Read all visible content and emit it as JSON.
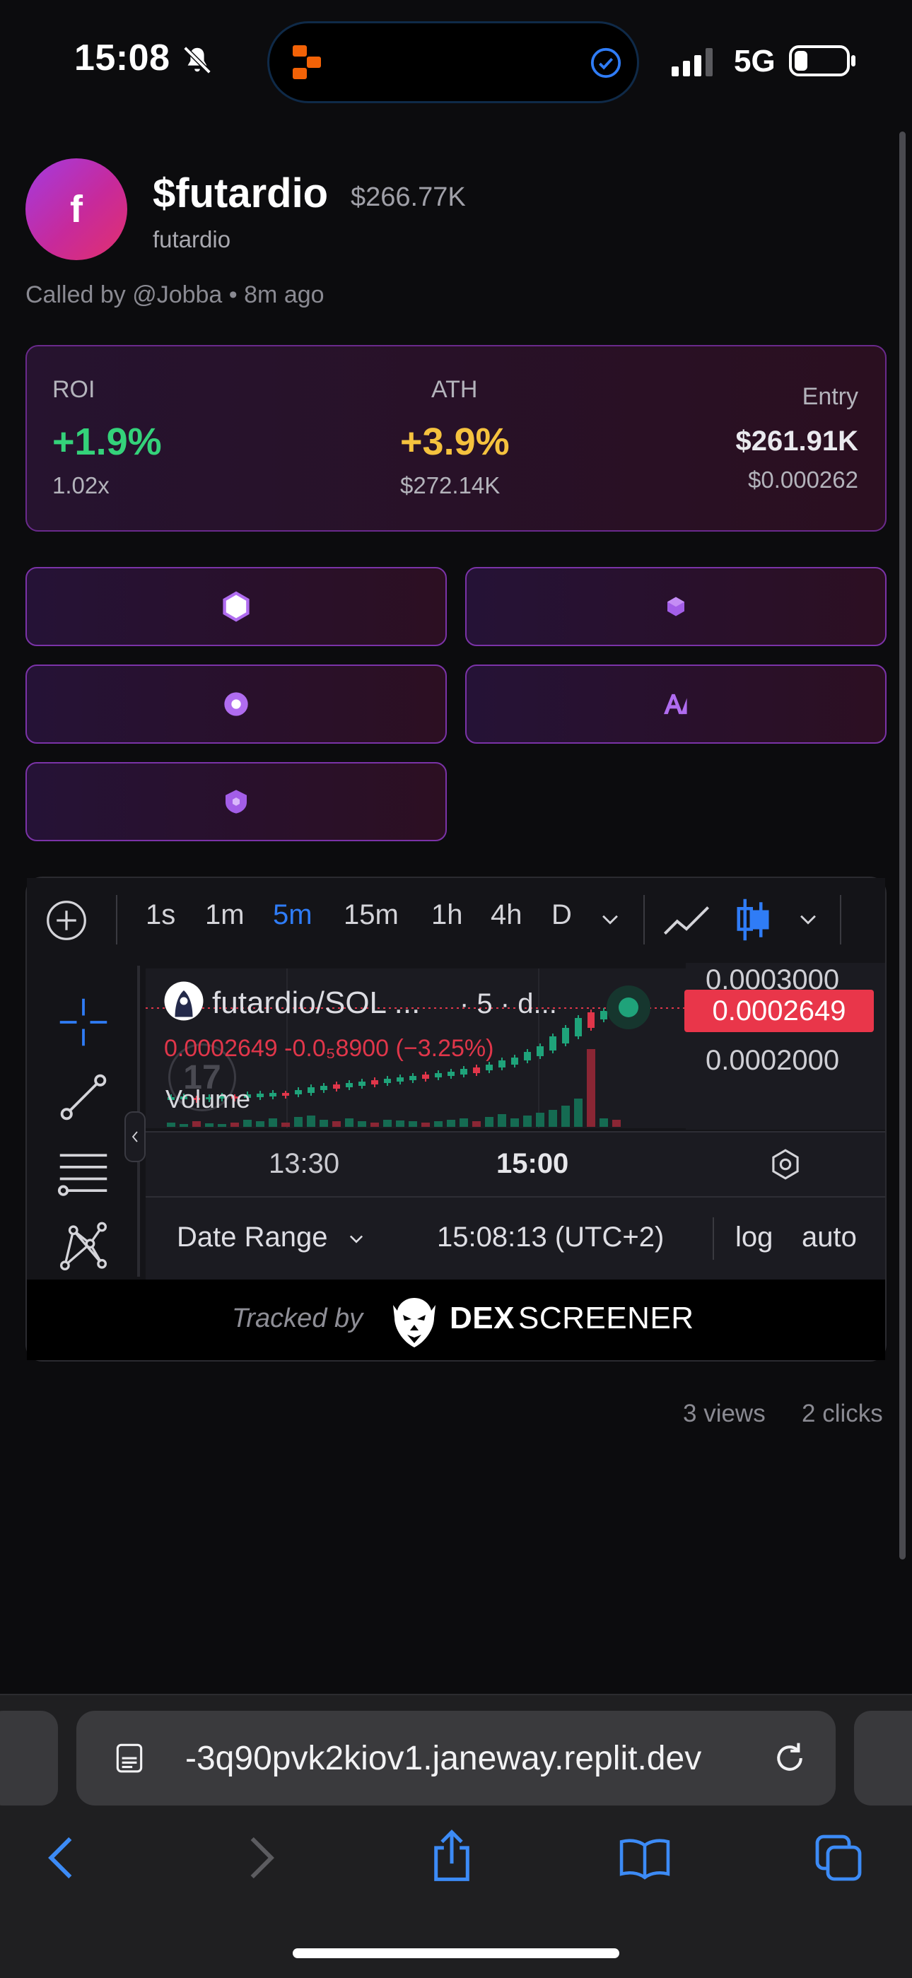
{
  "status_bar": {
    "time": "15:08",
    "network": "5G",
    "icons": [
      "bell-slash-icon",
      "replit-logo-icon",
      "check-circle-icon",
      "signal-icon",
      "battery-icon"
    ]
  },
  "token": {
    "avatar_letter": "f",
    "ticker": "$futardio",
    "market_cap": "$266.77K",
    "name": "futardio",
    "called_by": "Called by @Jobba • 8m ago"
  },
  "stats": {
    "roi_label": "ROI",
    "roi_value": "+1.9%",
    "roi_multiple": "1.02x",
    "ath_label": "ATH",
    "ath_value": "+3.9%",
    "ath_mcap": "$272.14K",
    "entry_label": "Entry",
    "entry_mcap": "$261.91K",
    "entry_price": "$0.000262",
    "colors": {
      "roi": "#34d27a",
      "ath": "#f5c23e"
    }
  },
  "links": [
    {
      "icon": "hexagon-icon"
    },
    {
      "icon": "cube-icon"
    },
    {
      "icon": "radio-circle-icon"
    },
    {
      "icon": "ai-logo-icon"
    },
    {
      "icon": "shield-icon"
    }
  ],
  "chart": {
    "timeframes": [
      "1s",
      "1m",
      "5m",
      "15m",
      "1h",
      "4h",
      "D"
    ],
    "active_timeframe": "5m",
    "pair": "futardio/SOL ...",
    "interval": "· 5 · d...",
    "ohlc": "0.0002649  -0.0₅8900 (−3.25%)",
    "volume_label": "Volume",
    "price_top": "0.0003000",
    "price_current": "0.0002649",
    "price_bottom": "0.0002000",
    "time_labels": [
      "13:30",
      "15:00"
    ],
    "date_range": "Date Range",
    "utc_time": "15:08:13 (UTC+2)",
    "log": "log",
    "auto": "auto",
    "tracked_by": "Tracked by",
    "brand_dex": "DEX",
    "brand_screener": "SCREENER",
    "colors": {
      "up": "#1fa37a",
      "down": "#e0364a",
      "active": "#2f7cf6"
    }
  },
  "engagement": {
    "views": "3 views",
    "clicks": "2 clicks"
  },
  "browser": {
    "url": "-3q90pvk2kiov1.janeway.replit.dev"
  }
}
